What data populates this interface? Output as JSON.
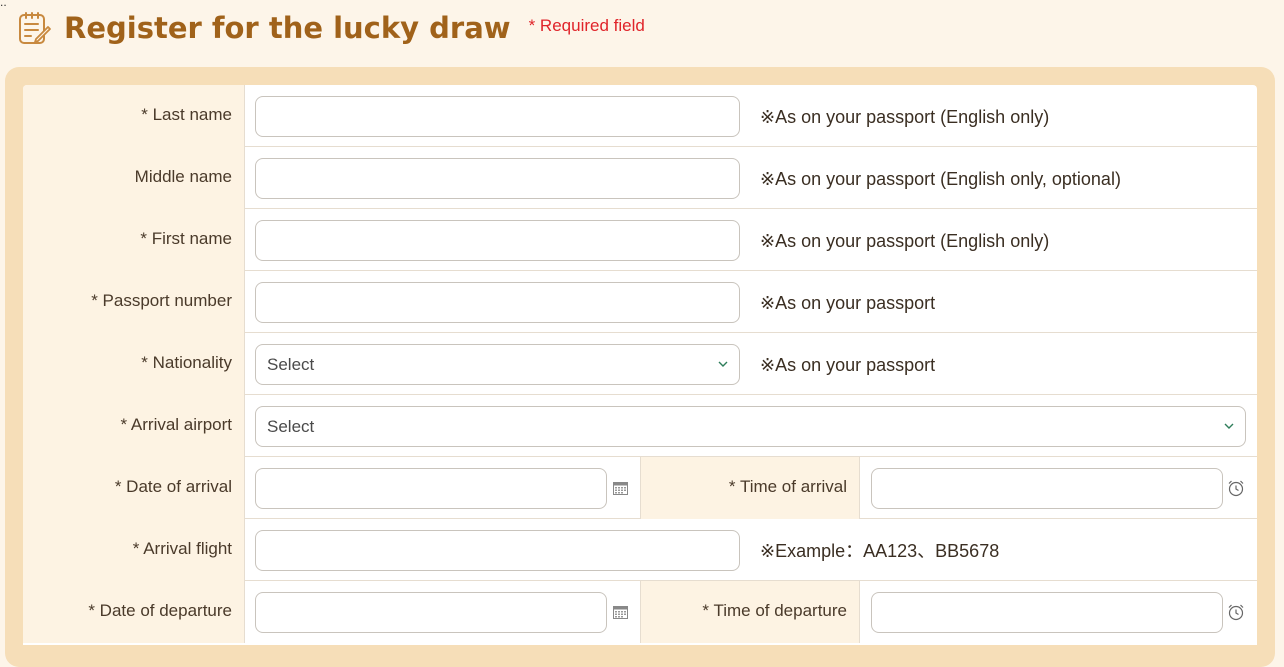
{
  "header": {
    "title": "Register for the lucky draw",
    "required_note": "* Required field"
  },
  "form": {
    "rows": [
      {
        "label": "* Last name",
        "note": "※As on your passport (English only)"
      },
      {
        "label": "Middle name",
        "note": "※As on your passport (English only, optional)"
      },
      {
        "label": "* First name",
        "note": "※As on your passport (English only)"
      },
      {
        "label": "* Passport number",
        "note": "※As on your passport"
      },
      {
        "label": "* Nationality",
        "select_value": "Select",
        "note": "※As on your passport"
      },
      {
        "label": "* Arrival airport",
        "select_value": "Select"
      },
      {
        "label": "* Date of arrival",
        "label2": "* Time of arrival"
      },
      {
        "label": "* Arrival flight",
        "note": "※Example：AA123、BB5678"
      },
      {
        "label": "* Date of departure",
        "label2": "* Time of departure"
      }
    ]
  },
  "colors": {
    "title": "#a0621a",
    "required": "#e0242a",
    "label_bg": "#fdf3e3",
    "frame": "#f6deb8",
    "page_bg": "#fdf5e9"
  }
}
